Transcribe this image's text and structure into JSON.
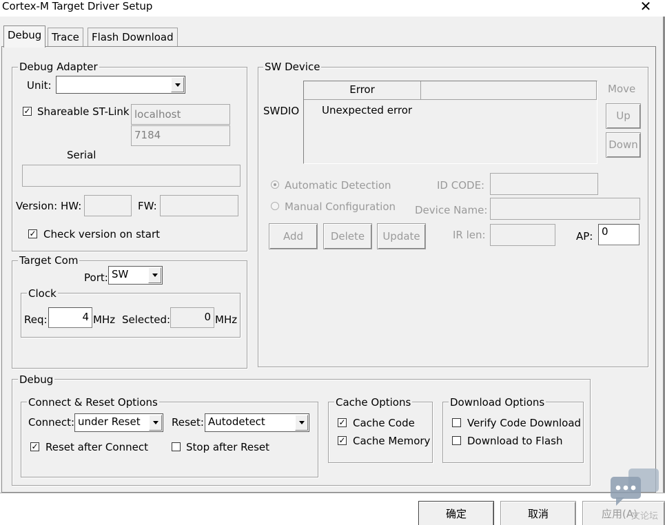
{
  "window": {
    "title": "Cortex-M Target Driver Setup",
    "close_glyph": "✕"
  },
  "tabs": [
    {
      "label": "Debug",
      "active": true
    },
    {
      "label": "Trace",
      "active": false
    },
    {
      "label": "Flash Download",
      "active": false
    }
  ],
  "debug_adapter": {
    "title": "Debug Adapter",
    "unit_label": "Unit:",
    "unit_value": "",
    "shareable_label": "Shareable ST-Link",
    "shareable_checked": true,
    "host": "localhost",
    "port": "7184",
    "serial_label": "Serial",
    "serial_value": "",
    "version_label": "Version: HW:",
    "fw_label": "FW:",
    "hw_value": "",
    "fw_value": "",
    "check_version_label": "Check version on start",
    "check_version_checked": true
  },
  "target_com": {
    "title": "Target Com",
    "port_label": "Port:",
    "port_value": "SW",
    "clock_title": "Clock",
    "req_label": "Req:",
    "req_value": "4",
    "req_unit": "MHz",
    "selected_label": "Selected:",
    "selected_value": "0",
    "selected_unit": "MHz"
  },
  "sw_device": {
    "title": "SW Device",
    "swdio_label": "SWDIO",
    "col_error": "Error",
    "col_blank": "",
    "error_text": "Unexpected error",
    "move_label": "Move",
    "up_label": "Up",
    "down_label": "Down",
    "auto_detect_label": "Automatic Detection",
    "manual_config_label": "Manual Configuration",
    "id_code_label": "ID CODE:",
    "device_name_label": "Device Name:",
    "add_label": "Add",
    "delete_label": "Delete",
    "update_label": "Update",
    "ir_len_label": "IR len:",
    "ap_label": "AP:",
    "ap_value": "0"
  },
  "debug": {
    "title": "Debug",
    "connect_reset_title": "Connect & Reset Options",
    "connect_label": "Connect:",
    "connect_value": "under Reset",
    "reset_label": "Reset:",
    "reset_value": "Autodetect",
    "reset_after_connect_label": "Reset after Connect",
    "reset_after_connect_checked": true,
    "stop_after_reset_label": "Stop after Reset",
    "stop_after_reset_checked": false,
    "cache_title": "Cache Options",
    "cache_code_label": "Cache Code",
    "cache_code_checked": true,
    "cache_memory_label": "Cache Memory",
    "cache_memory_checked": true,
    "download_title": "Download Options",
    "verify_label": "Verify Code Download",
    "verify_checked": false,
    "download_flash_label": "Download to Flash",
    "download_flash_checked": false
  },
  "footer": {
    "ok_label": "确定",
    "cancel_label": "取消",
    "apply_label": "应用(A)"
  },
  "watermark": {
    "text": "文论坛",
    "icon": "chat-bubble-icon"
  },
  "colors": {
    "dialog_bg": "#f0f0f0",
    "watermark_icon": "#a9b7c6"
  }
}
